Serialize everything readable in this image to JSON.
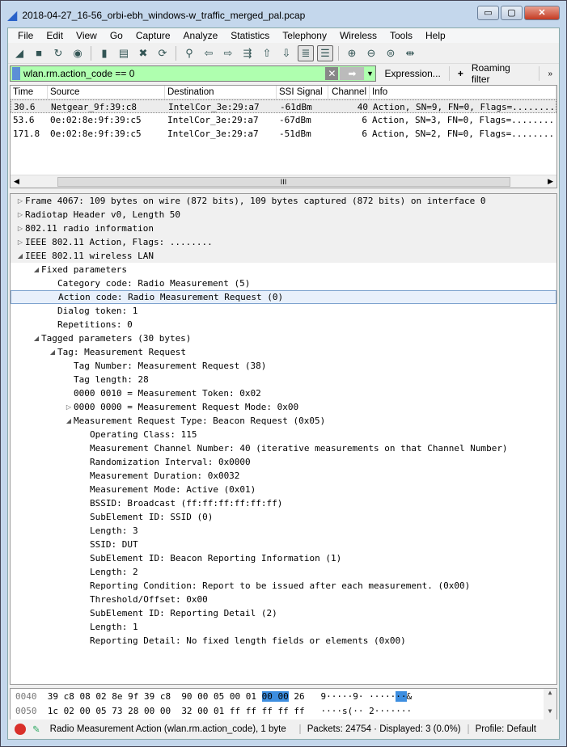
{
  "window": {
    "title": "2018-04-27_16-56_orbi-ebh_windows-w_traffic_merged_pal.pcap",
    "minimize": "▭",
    "maximize": "▢",
    "close": "✕"
  },
  "menu": [
    "File",
    "Edit",
    "View",
    "Go",
    "Capture",
    "Analyze",
    "Statistics",
    "Telephony",
    "Wireless",
    "Tools",
    "Help"
  ],
  "toolbar": [
    {
      "icon": "shark-fin-start-icon",
      "glyph": "◢"
    },
    {
      "icon": "stop-icon",
      "glyph": "■"
    },
    {
      "icon": "restart-icon",
      "glyph": "↻"
    },
    {
      "icon": "capture-options-icon",
      "glyph": "◉"
    },
    {
      "sep": true
    },
    {
      "icon": "open-file-icon",
      "glyph": "▮"
    },
    {
      "icon": "save-file-icon",
      "glyph": "▤"
    },
    {
      "icon": "close-file-icon",
      "glyph": "✖"
    },
    {
      "icon": "reload-icon",
      "glyph": "⟳"
    },
    {
      "sep": true
    },
    {
      "icon": "find-icon",
      "glyph": "⚲"
    },
    {
      "icon": "back-icon",
      "glyph": "⇦"
    },
    {
      "icon": "forward-icon",
      "glyph": "⇨"
    },
    {
      "icon": "go-to-packet-icon",
      "glyph": "⇶"
    },
    {
      "icon": "first-packet-icon",
      "glyph": "⇧"
    },
    {
      "icon": "last-packet-icon",
      "glyph": "⇩"
    },
    {
      "icon": "autoscroll-icon",
      "glyph": "≣",
      "on": true
    },
    {
      "icon": "colorize-icon",
      "glyph": "☰",
      "on": true
    },
    {
      "sep": true
    },
    {
      "icon": "zoom-in-icon",
      "glyph": "⊕"
    },
    {
      "icon": "zoom-out-icon",
      "glyph": "⊖"
    },
    {
      "icon": "zoom-reset-icon",
      "glyph": "⊜"
    },
    {
      "icon": "resize-columns-icon",
      "glyph": "⇹"
    }
  ],
  "filter": {
    "value": "wlan.rm.action_code == 0",
    "clear": "✕",
    "apply": "➡",
    "dropdown": "▼",
    "expression": "Expression...",
    "add": "+",
    "roaming": "Roaming filter",
    "more": "»",
    "bg": "#afffaf"
  },
  "packet_list": {
    "columns": [
      "Time",
      "Source",
      "Destination",
      "SSI Signal",
      "Channel",
      "Info"
    ],
    "rows": [
      [
        "30.6",
        "Netgear_9f:39:c8",
        "IntelCor_3e:29:a7",
        "-61dBm",
        "40",
        "Action, SN=9, FN=0, Flags=........"
      ],
      [
        "53.6",
        "0e:02:8e:9f:39:c5",
        "IntelCor_3e:29:a7",
        "-67dBm",
        "6",
        "Action, SN=3, FN=0, Flags=........"
      ],
      [
        "171.8",
        "0e:02:8e:9f:39:c5",
        "IntelCor_3e:29:a7",
        "-51dBm",
        "6",
        "Action, SN=2, FN=0, Flags=........"
      ]
    ],
    "selected_row": 0,
    "hscroll": {
      "left": "◀",
      "thumb": "III",
      "right": "▶"
    }
  },
  "details": [
    {
      "level": 0,
      "exp": "closed",
      "text": "Frame 4067: 109 bytes on wire (872 bits), 109 bytes captured (872 bits) on interface 0"
    },
    {
      "level": 0,
      "exp": "closed",
      "text": "Radiotap Header v0, Length 50"
    },
    {
      "level": 0,
      "exp": "closed",
      "text": "802.11 radio information"
    },
    {
      "level": 0,
      "exp": "closed",
      "text": "IEEE 802.11 Action, Flags: ........"
    },
    {
      "level": 0,
      "exp": "open",
      "text": "IEEE 802.11 wireless LAN"
    },
    {
      "level": 1,
      "exp": "open",
      "text": "Fixed parameters"
    },
    {
      "level": 2,
      "exp": "none",
      "text": "Category code: Radio Measurement (5)"
    },
    {
      "level": 2,
      "exp": "none",
      "text": "Action code: Radio Measurement Request (0)",
      "selected": true
    },
    {
      "level": 2,
      "exp": "none",
      "text": "Dialog token: 1"
    },
    {
      "level": 2,
      "exp": "none",
      "text": "Repetitions: 0"
    },
    {
      "level": 1,
      "exp": "open",
      "text": "Tagged parameters (30 bytes)"
    },
    {
      "level": 2,
      "exp": "open",
      "text": "Tag: Measurement Request"
    },
    {
      "level": 3,
      "exp": "none",
      "text": "Tag Number: Measurement Request (38)"
    },
    {
      "level": 3,
      "exp": "none",
      "text": "Tag length: 28"
    },
    {
      "level": 3,
      "exp": "none",
      "text": "0000 0010 = Measurement Token: 0x02"
    },
    {
      "level": 3,
      "exp": "closed",
      "text": "0000 0000 = Measurement Request Mode: 0x00"
    },
    {
      "level": 3,
      "exp": "open",
      "text": "Measurement Request Type: Beacon Request (0x05)"
    },
    {
      "level": 4,
      "exp": "none",
      "text": "Operating Class: 115"
    },
    {
      "level": 4,
      "exp": "none",
      "text": "Measurement Channel Number: 40 (iterative measurements on that Channel Number)"
    },
    {
      "level": 4,
      "exp": "none",
      "text": "Randomization Interval: 0x0000"
    },
    {
      "level": 4,
      "exp": "none",
      "text": "Measurement Duration: 0x0032"
    },
    {
      "level": 4,
      "exp": "none",
      "text": "Measurement Mode: Active (0x01)"
    },
    {
      "level": 4,
      "exp": "none",
      "text": "BSSID: Broadcast (ff:ff:ff:ff:ff:ff)"
    },
    {
      "level": 4,
      "exp": "none",
      "text": "SubElement ID: SSID (0)"
    },
    {
      "level": 4,
      "exp": "none",
      "text": "Length: 3"
    },
    {
      "level": 4,
      "exp": "none",
      "text": "SSID: DUT"
    },
    {
      "level": 4,
      "exp": "none",
      "text": "SubElement ID: Beacon Reporting Information (1)"
    },
    {
      "level": 4,
      "exp": "none",
      "text": "Length: 2"
    },
    {
      "level": 4,
      "exp": "none",
      "text": "Reporting Condition: Report to be issued after each measurement. (0x00)"
    },
    {
      "level": 4,
      "exp": "none",
      "text": "Threshold/Offset: 0x00"
    },
    {
      "level": 4,
      "exp": "none",
      "text": "SubElement ID: Reporting Detail (2)"
    },
    {
      "level": 4,
      "exp": "none",
      "text": "Length: 1"
    },
    {
      "level": 4,
      "exp": "none",
      "text": "Reporting Detail: No fixed length fields or elements (0x00)"
    }
  ],
  "hex": [
    {
      "offset": "0040",
      "pre": "39 c8 08 02 8e 9f 39 c8  90 00 05 00 01 ",
      "hl": "00 00",
      "post": " 26   ",
      "ascii_pre": "9·····9· ·····",
      "ascii_hl": "··",
      "ascii_post": "&"
    },
    {
      "offset": "0050",
      "pre": "1c 02 00 05 73 28 00 00  32 00 01 ff ff ff ff ff   ",
      "hl": "",
      "post": "",
      "ascii_pre": "····s(·· 2·······",
      "ascii_hl": "",
      "ascii_post": ""
    }
  ],
  "hex_scroll": {
    "up": "▲",
    "down": "▼"
  },
  "status": {
    "field": "Radio Measurement Action (wlan.rm.action_code), 1 byte",
    "packets": "Packets: 24754 · Displayed: 3 (0.0%)",
    "profile": "Profile: Default"
  }
}
